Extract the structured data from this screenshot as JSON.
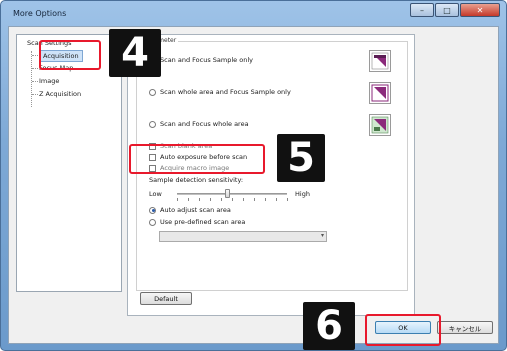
{
  "window": {
    "title": "More Options",
    "close_glyph": "✕",
    "minimize_glyph": "–",
    "maximize_glyph": "□"
  },
  "tree": {
    "items": [
      {
        "label": "Scan Settings"
      },
      {
        "label": "Acquisition"
      },
      {
        "label": "Focus Map"
      },
      {
        "label": "Image"
      },
      {
        "label": "Z Acquisition"
      }
    ]
  },
  "panel": {
    "group_legend": "Parameter",
    "options": [
      {
        "label": "Scan and Focus Sample only",
        "checked": false
      },
      {
        "label": "Scan whole area and Focus Sample only",
        "checked": false
      },
      {
        "label": "Scan and Focus whole area",
        "checked": false
      }
    ],
    "checkboxes": [
      {
        "label": "Scan blank area"
      },
      {
        "label": "Auto exposure before scan"
      },
      {
        "label": "Acquire macro image"
      }
    ],
    "sensitivity": {
      "label": "Sample detection sensitivity:",
      "low": "Low",
      "high": "High",
      "value": 0.45
    },
    "area_options": [
      {
        "label": "Auto adjust scan area",
        "checked": true
      },
      {
        "label": "Use pre-defined scan area",
        "checked": false
      }
    ],
    "dropdown_value": "",
    "default_button": "Default"
  },
  "footer": {
    "ok": "OK",
    "cancel": "キャンセル"
  },
  "callouts": {
    "step4": "4",
    "step5": "5",
    "step6": "6",
    "accent": "#e8192c"
  },
  "icons": {
    "thumb": "scan-area-preview-icon"
  }
}
